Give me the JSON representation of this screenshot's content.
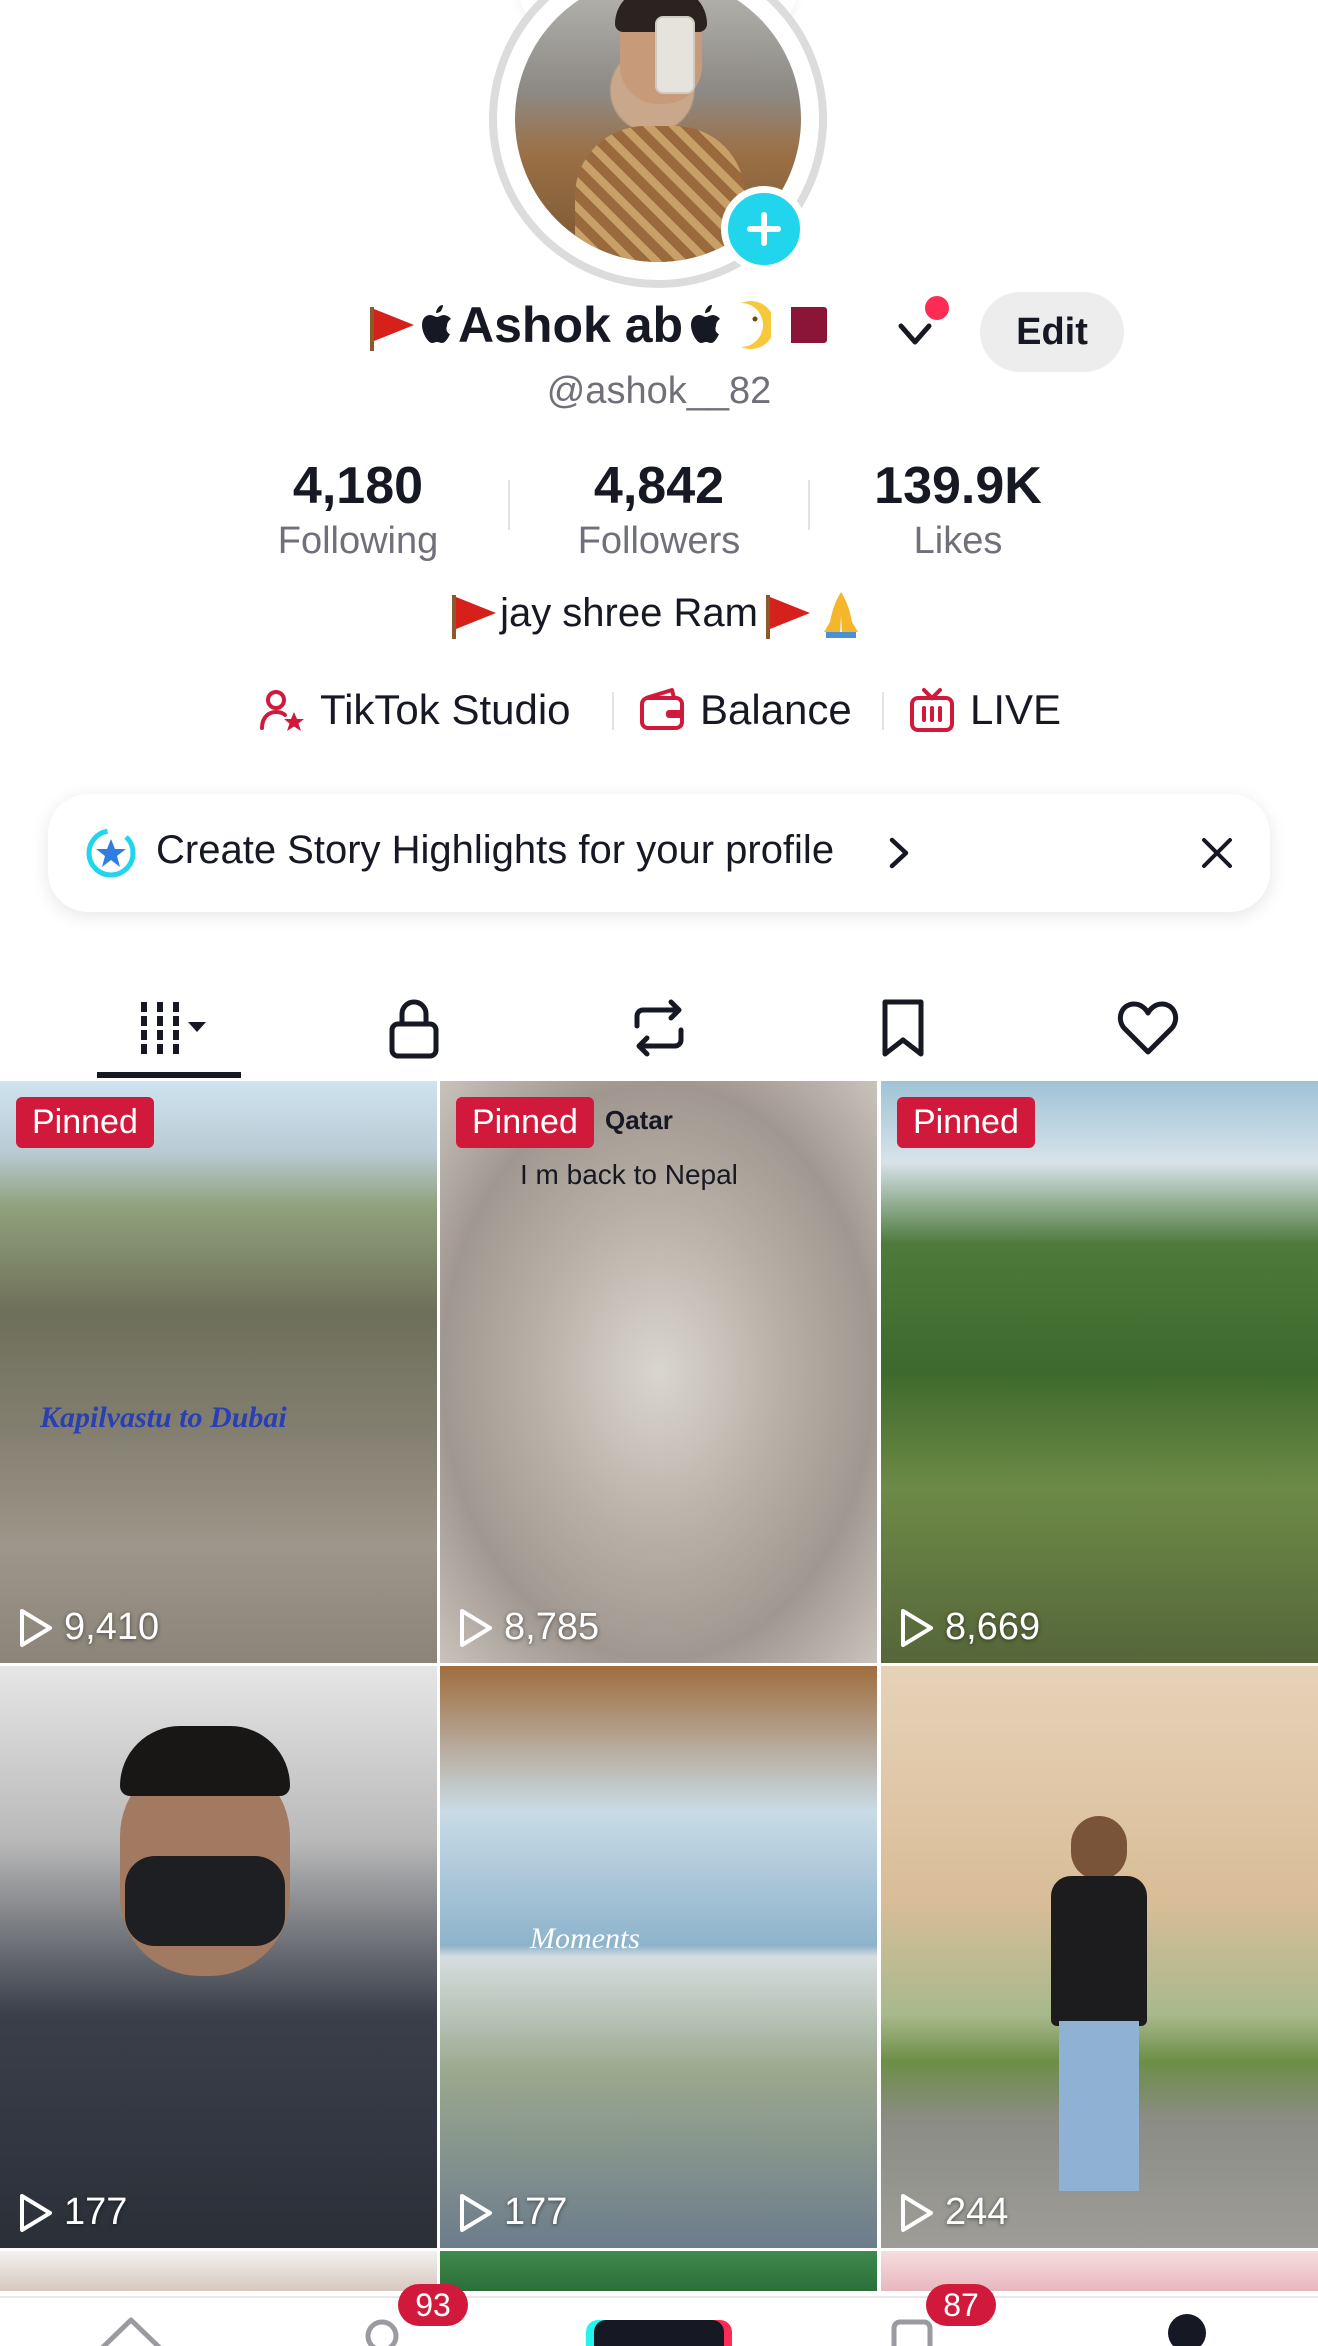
{
  "profile": {
    "display_name": "Ashok ab",
    "username": "@ashok__82",
    "edit_label": "Edit",
    "bio": "jay shree Ram"
  },
  "stats": [
    {
      "value": "4,180",
      "label": "Following"
    },
    {
      "value": "4,842",
      "label": "Followers"
    },
    {
      "value": "139.9K",
      "label": "Likes"
    }
  ],
  "quick_links": [
    {
      "label": "TikTok Studio",
      "icon": "creator-icon"
    },
    {
      "label": "Balance",
      "icon": "wallet-icon"
    },
    {
      "label": "LIVE",
      "icon": "live-tv-icon"
    }
  ],
  "banner": {
    "text": "Create Story Highlights for your profile"
  },
  "tabs": [
    {
      "icon": "videos-grid-icon",
      "active": true
    },
    {
      "icon": "lock-icon"
    },
    {
      "icon": "repost-icon"
    },
    {
      "icon": "bookmark-icon"
    },
    {
      "icon": "heart-icon"
    }
  ],
  "videos": [
    {
      "pinned": "Pinned",
      "views": "9,410",
      "overlay": "Kapilvastu to Dubai"
    },
    {
      "pinned": "Pinned",
      "views": "8,785",
      "overlay": "I m back to Nepal",
      "overlay_top": "Qatar"
    },
    {
      "pinned": "Pinned",
      "views": "8,669"
    },
    {
      "views": "177"
    },
    {
      "views": "177",
      "overlay": "Moments"
    },
    {
      "views": "244"
    }
  ],
  "bottom_nav": {
    "search_badge": "93",
    "inbox_badge": "87"
  },
  "colors": {
    "accent": "#fe2c55",
    "badge": "#d11a3b",
    "cyan": "#20d5ec",
    "text": "#161823",
    "muted": "#6f7079"
  }
}
